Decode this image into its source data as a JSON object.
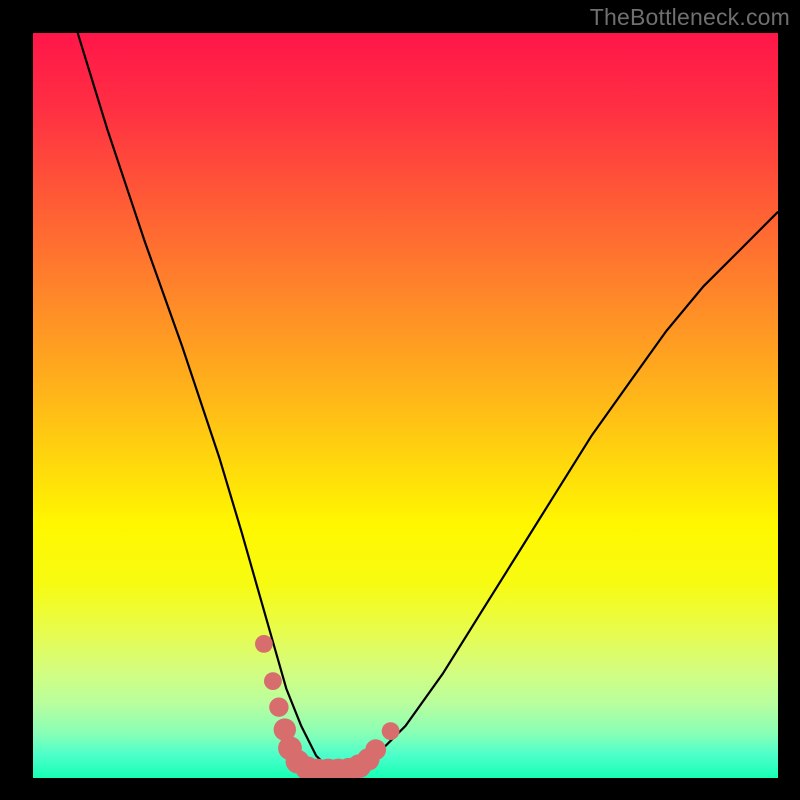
{
  "watermark": "TheBottleneck.com",
  "chart_data": {
    "type": "line",
    "title": "",
    "xlabel": "",
    "ylabel": "",
    "xlim": [
      0,
      100
    ],
    "ylim": [
      0,
      100
    ],
    "series": [
      {
        "name": "bottleneck-curve",
        "x": [
          6,
          10,
          15,
          20,
          25,
          28,
          30,
          32,
          34,
          36,
          38,
          40,
          42,
          45,
          50,
          55,
          60,
          65,
          70,
          75,
          80,
          85,
          90,
          95,
          100
        ],
        "y": [
          100,
          87,
          72,
          58,
          43,
          33,
          26,
          19,
          12,
          7,
          3,
          1,
          1,
          2,
          7,
          14,
          22,
          30,
          38,
          46,
          53,
          60,
          66,
          71,
          76
        ]
      }
    ],
    "markers": {
      "name": "highlight-dots",
      "color": "#d86d6d",
      "points": [
        {
          "x": 31.0,
          "y": 18.0,
          "r": 1.2
        },
        {
          "x": 32.2,
          "y": 13.0,
          "r": 1.2
        },
        {
          "x": 33.0,
          "y": 9.5,
          "r": 1.3
        },
        {
          "x": 33.8,
          "y": 6.5,
          "r": 1.5
        },
        {
          "x": 34.5,
          "y": 4.0,
          "r": 1.6
        },
        {
          "x": 35.5,
          "y": 2.2,
          "r": 1.6
        },
        {
          "x": 36.8,
          "y": 1.3,
          "r": 1.6
        },
        {
          "x": 38.2,
          "y": 1.0,
          "r": 1.6
        },
        {
          "x": 39.6,
          "y": 1.0,
          "r": 1.6
        },
        {
          "x": 41.0,
          "y": 1.0,
          "r": 1.6
        },
        {
          "x": 42.4,
          "y": 1.1,
          "r": 1.6
        },
        {
          "x": 43.8,
          "y": 1.6,
          "r": 1.6
        },
        {
          "x": 45.0,
          "y": 2.5,
          "r": 1.5
        },
        {
          "x": 46.0,
          "y": 3.8,
          "r": 1.4
        },
        {
          "x": 48.0,
          "y": 6.3,
          "r": 1.2
        }
      ]
    },
    "gradient_stops": [
      {
        "pos": 0.0,
        "color": "#ff1649"
      },
      {
        "pos": 0.22,
        "color": "#ff5936"
      },
      {
        "pos": 0.48,
        "color": "#ffb31a"
      },
      {
        "pos": 0.66,
        "color": "#fff700"
      },
      {
        "pos": 0.9,
        "color": "#b9fe9e"
      },
      {
        "pos": 1.0,
        "color": "#16ffb4"
      }
    ]
  }
}
